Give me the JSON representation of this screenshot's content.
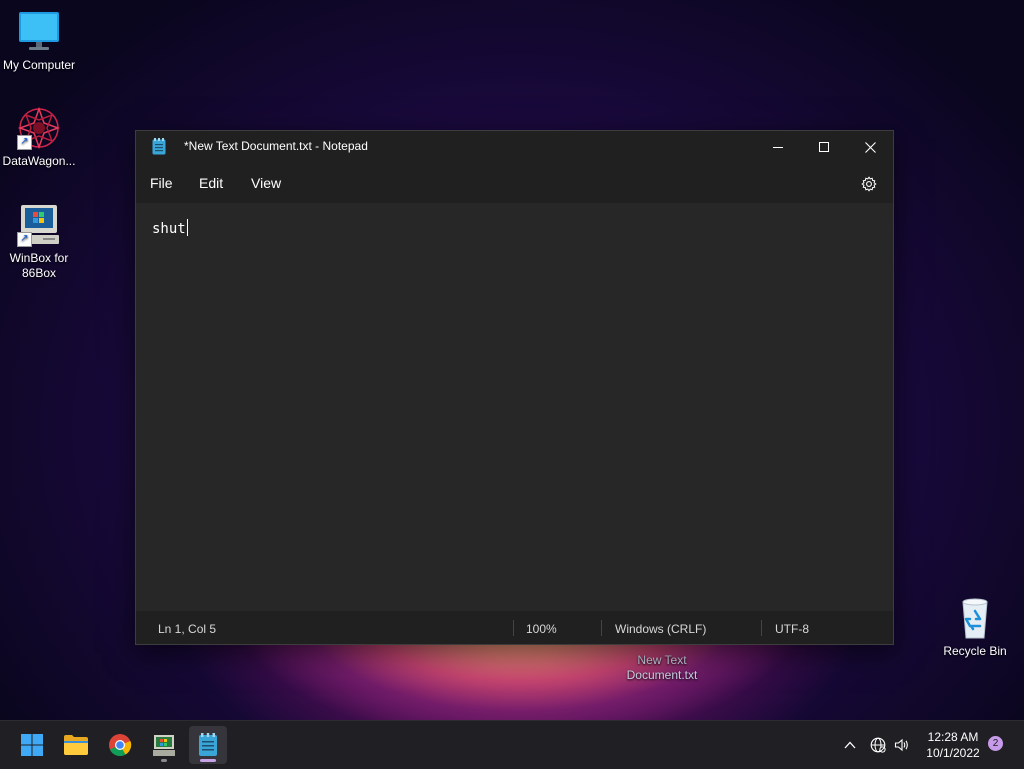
{
  "desktop": {
    "icons": [
      {
        "label": "My Computer"
      },
      {
        "label": "DataWagon..."
      },
      {
        "label_line1": "WinBox for",
        "label_line2": "86Box"
      },
      {
        "label": "Recycle Bin"
      },
      {
        "label_line1": "New Text",
        "label_line2": "Document.txt"
      }
    ]
  },
  "window": {
    "title": "*New Text Document.txt - Notepad",
    "menu": {
      "file": "File",
      "edit": "Edit",
      "view": "View"
    },
    "content": "shut",
    "status": {
      "position": "Ln 1, Col 5",
      "zoom": "100%",
      "line_ending": "Windows (CRLF)",
      "encoding": "UTF-8"
    }
  },
  "taskbar": {
    "clock_time": "12:28 AM",
    "clock_date": "10/1/2022",
    "notification_count": "2"
  }
}
